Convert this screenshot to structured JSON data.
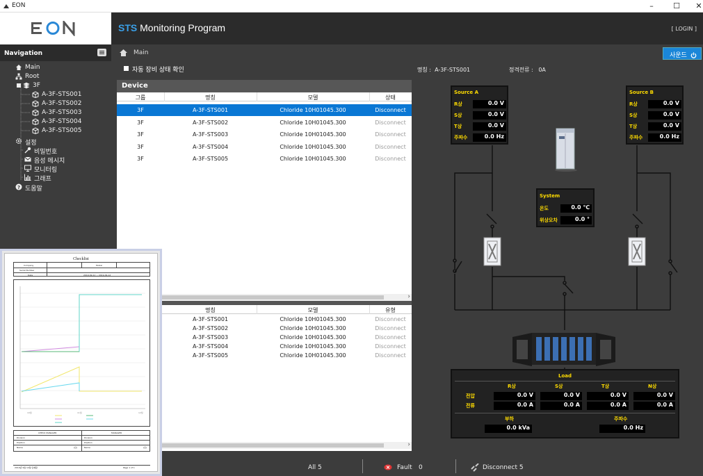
{
  "window": {
    "title": "EON",
    "min": "–",
    "max": "☐",
    "close": "✕"
  },
  "header": {
    "logo": "EON",
    "title_bold": "STS",
    "title_rest": " Monitoring Program",
    "login": "[ LOGIN ]"
  },
  "nav": {
    "heading": "Navigation",
    "items": [
      {
        "label": "Main",
        "icon": "home-icon"
      },
      {
        "label": "Root",
        "icon": "org-icon"
      },
      {
        "label": "3F",
        "icon": "layers-icon"
      },
      {
        "label": "A-3F-STS001",
        "icon": "device-icon"
      },
      {
        "label": "A-3F-STS002",
        "icon": "device-icon"
      },
      {
        "label": "A-3F-STS003",
        "icon": "device-icon"
      },
      {
        "label": "A-3F-STS004",
        "icon": "device-icon"
      },
      {
        "label": "A-3F-STS005",
        "icon": "device-icon"
      },
      {
        "label": "설정",
        "icon": "gear-icon"
      },
      {
        "label": "비밀번호",
        "icon": "key-icon"
      },
      {
        "label": "음성 메시지",
        "icon": "mail-icon"
      },
      {
        "label": "모니터링",
        "icon": "monitor-icon"
      },
      {
        "label": "그래프",
        "icon": "chart-icon"
      },
      {
        "label": "도움말",
        "icon": "help-icon"
      }
    ]
  },
  "toolbar": {
    "crumb": "Main",
    "sound_label": "사운드"
  },
  "subbar": {
    "auto_check": "자동 장비 상태 확인",
    "name_label": "명칭 :",
    "name_value": "A-3F-STS001",
    "current_label": "정격전류 :",
    "current_value": "0A"
  },
  "device": {
    "heading": "Device",
    "columns": [
      "그룹",
      "명칭",
      "모델",
      "상태"
    ],
    "rows": [
      [
        "3F",
        "A-3F-STS001",
        "Chloride 10H01045.300",
        "Disconnect"
      ],
      [
        "3F",
        "A-3F-STS002",
        "Chloride 10H01045.300",
        "Disconnect"
      ],
      [
        "3F",
        "A-3F-STS003",
        "Chloride 10H01045.300",
        "Disconnect"
      ],
      [
        "3F",
        "A-3F-STS004",
        "Chloride 10H01045.300",
        "Disconnect"
      ],
      [
        "3F",
        "A-3F-STS005",
        "Chloride 10H01045.300",
        "Disconnect"
      ]
    ]
  },
  "events": {
    "columns": [
      "명칭",
      "모델",
      "유형"
    ],
    "rows": [
      [
        "A-3F-STS001",
        "Chloride 10H01045.300",
        "Disconnect"
      ],
      [
        "A-3F-STS002",
        "Chloride 10H01045.300",
        "Disconnect"
      ],
      [
        "A-3F-STS003",
        "Chloride 10H01045.300",
        "Disconnect"
      ],
      [
        "A-3F-STS004",
        "Chloride 10H01045.300",
        "Disconnect"
      ],
      [
        "A-3F-STS005",
        "Chloride 10H01045.300",
        "Disconnect"
      ]
    ]
  },
  "sourceA": {
    "title": "Source A",
    "rows": [
      [
        "R상",
        "0.0",
        "V"
      ],
      [
        "S상",
        "0.0",
        "V"
      ],
      [
        "T상",
        "0.0",
        "V"
      ],
      [
        "주파수",
        "0.0",
        "Hz"
      ]
    ]
  },
  "sourceB": {
    "title": "Source B",
    "rows": [
      [
        "R상",
        "0.0",
        "V"
      ],
      [
        "S상",
        "0.0",
        "V"
      ],
      [
        "T상",
        "0.0",
        "V"
      ],
      [
        "주파수",
        "0.0",
        "Hz"
      ]
    ]
  },
  "system": {
    "title": "System",
    "rows": [
      [
        "온도",
        "0.0",
        "℃"
      ],
      [
        "위상오차",
        "0.0",
        "°"
      ]
    ]
  },
  "load": {
    "title": "Load",
    "phases": [
      "R상",
      "S상",
      "T상",
      "N상"
    ],
    "voltage_label": "전압",
    "current_label": "전류",
    "voltage": [
      "0.0",
      "0.0",
      "0.0",
      "0.0"
    ],
    "current": [
      "0.0",
      "0.0",
      "0.0",
      "0.0"
    ],
    "voltage_unit": "V",
    "current_unit": "A",
    "power_label": "부하",
    "power": "0.0",
    "power_unit": "kVa",
    "freq_label": "주파수",
    "freq": "0.0",
    "freq_unit": "Hz"
  },
  "status": {
    "all": "All 5",
    "fault_label": "Fault",
    "fault": "0",
    "disconnect": "Disconnect 5"
  },
  "checklist": {
    "title": "Checklist",
    "info_rows": [
      [
        "Company",
        "Model"
      ],
      [
        "Serial Number",
        ""
      ],
      [
        "Date",
        "2019-09-11 ~ 2019-09-12"
      ]
    ],
    "sign_heads": [
      "CHECK MANAGER",
      "MANAGER"
    ],
    "sign_rows": [
      "Division",
      "Position",
      "Name"
    ],
    "sign_end": "(인)",
    "footer_left": "2019년 9월 12일 인쇄함",
    "footer_right": "Page 1 of 1"
  }
}
